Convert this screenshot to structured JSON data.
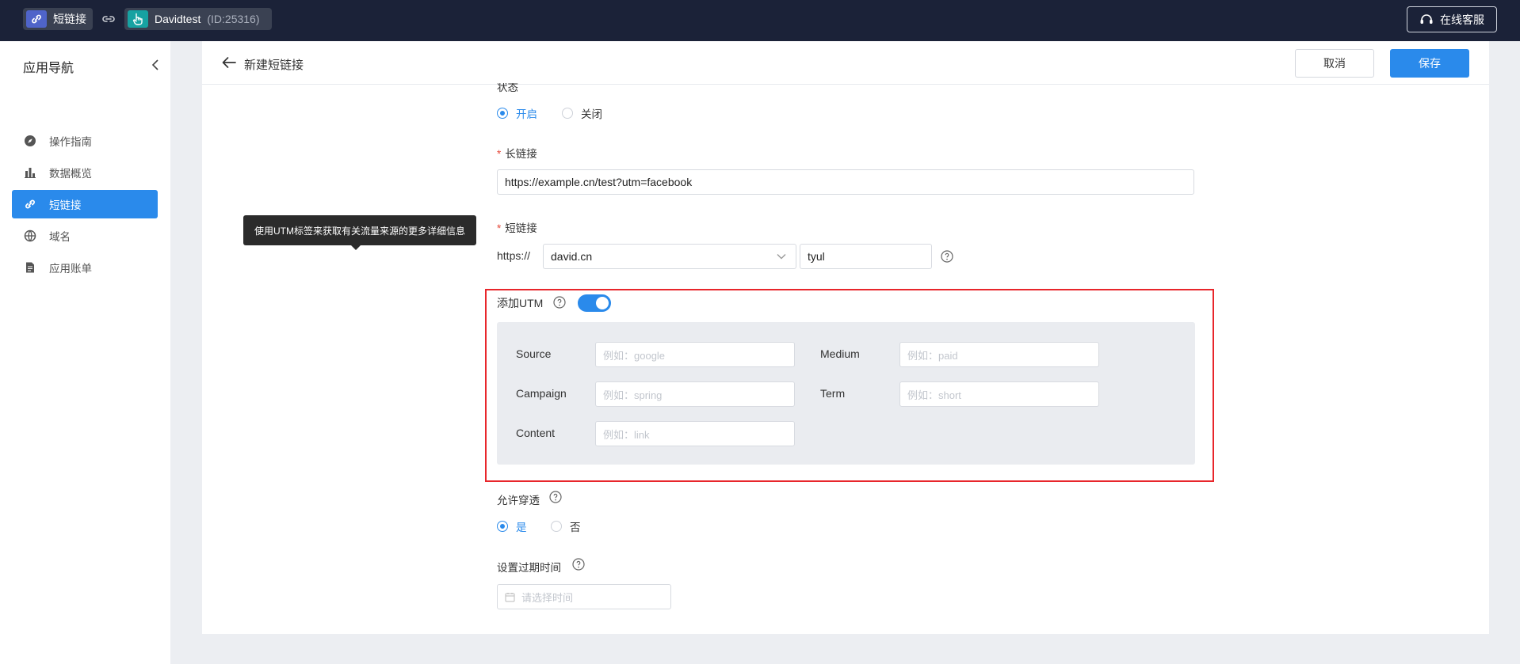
{
  "topbar": {
    "app_name": "短链接",
    "account_name": "Davidtest",
    "account_id": "(ID:25316)",
    "support_label": "在线客服"
  },
  "sidebar": {
    "title": "应用导航",
    "items": [
      {
        "label": "操作指南",
        "icon": "compass-icon"
      },
      {
        "label": "数据概览",
        "icon": "bar-chart-icon"
      },
      {
        "label": "短链接",
        "icon": "link-icon",
        "active": true
      },
      {
        "label": "域名",
        "icon": "globe-icon"
      },
      {
        "label": "应用账单",
        "icon": "document-icon"
      }
    ]
  },
  "header": {
    "title": "新建短链接",
    "cancel_label": "取消",
    "save_label": "保存"
  },
  "form": {
    "status": {
      "label": "状态",
      "options": [
        "开启",
        "关闭"
      ],
      "selected": "开启"
    },
    "long_link": {
      "label": "长链接",
      "value": "https://example.cn/test?utm=facebook"
    },
    "short_link": {
      "label": "短链接",
      "prefix": "https://",
      "domain": "david.cn",
      "path": "tyul"
    },
    "utm": {
      "label": "添加UTM",
      "enabled": true,
      "tooltip": "使用UTM标签来获取有关流量来源的更多详细信息",
      "fields": {
        "source": {
          "label": "Source",
          "placeholder": "例如：google"
        },
        "medium": {
          "label": "Medium",
          "placeholder": "例如：paid"
        },
        "campaign": {
          "label": "Campaign",
          "placeholder": "例如：spring"
        },
        "term": {
          "label": "Term",
          "placeholder": "例如：short"
        },
        "content": {
          "label": "Content",
          "placeholder": "例如：link"
        }
      }
    },
    "passthrough": {
      "label": "允许穿透",
      "options": [
        "是",
        "否"
      ],
      "selected": "是"
    },
    "expire": {
      "label": "设置过期时间",
      "placeholder": "请选择时间"
    }
  },
  "colors": {
    "accent": "#2a8aeb",
    "topbar_bg": "#1b2238",
    "highlight_frame": "#e8262b"
  }
}
